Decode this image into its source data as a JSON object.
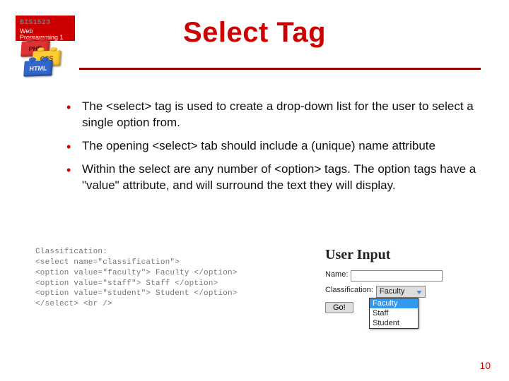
{
  "course": {
    "code": "BIS1523",
    "name": "Web Programming 1"
  },
  "bricks": [
    "PHP",
    "CSS",
    "HTML"
  ],
  "title": "Select Tag",
  "bullets": [
    "The <select> tag is used to create a drop-down list for the user to select a single option from.",
    "The opening <select> tab should include a (unique) name attribute",
    "Within the select are any number of <option> tags.  The option tags have a \"value\" attribute, and will surround the text they will display."
  ],
  "code_sample": [
    "Classification:",
    "<select name=\"classification\">",
    "<option value=\"faculty\"> Faculty </option>",
    "<option value=\"staff\"> Staff </option>",
    "<option value=\"student\"> Student </option>",
    "  </select> <br />"
  ],
  "demo": {
    "heading": "User Input",
    "name_label": "Name:",
    "name_value": "",
    "class_label": "Classification:",
    "selected": "Faculty",
    "options": [
      "Faculty",
      "Staff",
      "Student"
    ],
    "submit": "Go!"
  },
  "page_number": "10"
}
